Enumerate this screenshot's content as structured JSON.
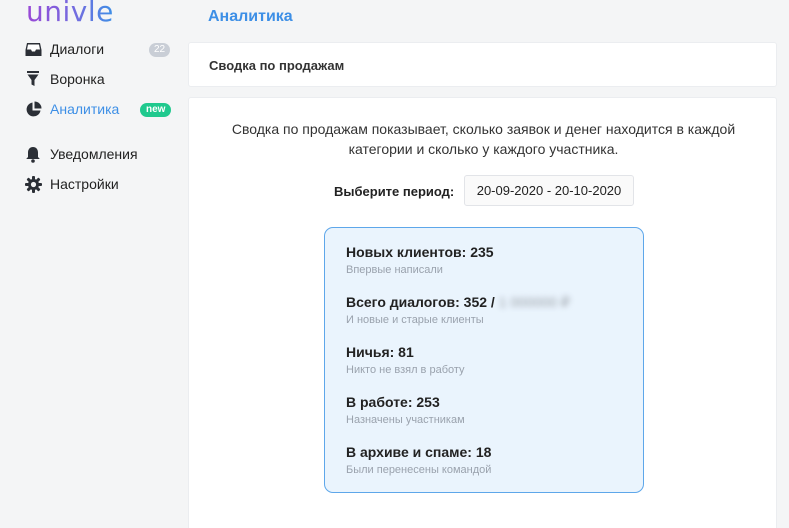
{
  "app": {
    "logo": "univle"
  },
  "sidebar": {
    "items": [
      {
        "label": "Диалоги",
        "icon": "inbox-icon",
        "badge": "22"
      },
      {
        "label": "Воронка",
        "icon": "funnel-icon"
      },
      {
        "label": "Аналитика",
        "icon": "pie-chart-icon",
        "badge": "new",
        "active": true
      },
      {
        "label": "Уведомления",
        "icon": "bell-icon"
      },
      {
        "label": "Настройки",
        "icon": "gear-icon"
      }
    ]
  },
  "header": {
    "title": "Аналитика"
  },
  "report": {
    "title": "Сводка по продажам",
    "description_line1": "Сводка по продажам показывает, сколько заявок и денег находится в каждой",
    "description_line2": "категории и сколько у каждого участника.",
    "period_label": "Выберите период:",
    "period_value": "20-09-2020 - 20-10-2020"
  },
  "stats": [
    {
      "label": "Новых клиентов: 235",
      "sub": "Впервые написали"
    },
    {
      "label": "Всего диалогов: 352 / ",
      "blurred": "1 000000 ₽",
      "sub": "И новые и старые клиенты"
    },
    {
      "label": "Ничья: 81",
      "sub": "Никто не взял в работу"
    },
    {
      "label": "В работе: 253",
      "sub": "Назначены участникам"
    },
    {
      "label": "В архиве и спаме: 18",
      "sub": "Были перенесены командой"
    }
  ],
  "colors": {
    "accent": "#3d8fe6",
    "new_badge": "#20c98e",
    "stats_bg": "#eaf4fd",
    "stats_border": "#5ea7ea"
  }
}
